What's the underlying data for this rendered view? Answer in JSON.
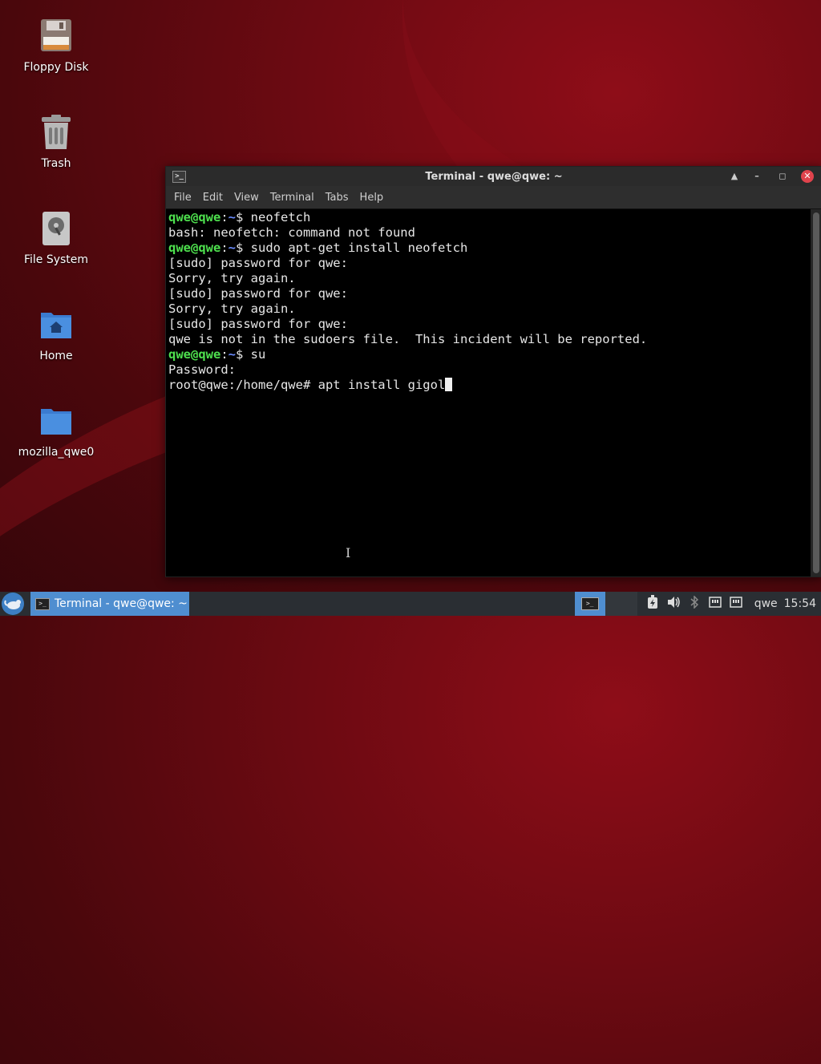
{
  "desktop": {
    "icons": [
      {
        "label": "Floppy Disk"
      },
      {
        "label": "Trash"
      },
      {
        "label": "File System"
      },
      {
        "label": "Home"
      },
      {
        "label": "mozilla_qwe0"
      }
    ]
  },
  "terminal": {
    "title": "Terminal - qwe@qwe: ~",
    "menu": [
      "File",
      "Edit",
      "View",
      "Terminal",
      "Tabs",
      "Help"
    ],
    "lines": [
      {
        "user": "qwe@qwe",
        "path": "~",
        "cmd": "$ neofetch"
      },
      {
        "text": "bash: neofetch: command not found"
      },
      {
        "user": "qwe@qwe",
        "path": "~",
        "cmd": "$ sudo apt-get install neofetch"
      },
      {
        "text": "[sudo] password for qwe:"
      },
      {
        "text": "Sorry, try again."
      },
      {
        "text": "[sudo] password for qwe:"
      },
      {
        "text": "Sorry, try again."
      },
      {
        "text": "[sudo] password for qwe:"
      },
      {
        "text": "qwe is not in the sudoers file.  This incident will be reported."
      },
      {
        "user": "qwe@qwe",
        "path": "~",
        "cmd": "$ su"
      },
      {
        "text": "Password:"
      },
      {
        "text": "root@qwe:/home/qwe# apt install gigol",
        "cursor": true
      }
    ]
  },
  "taskbar": {
    "task_label": "Terminal - qwe@qwe: ~",
    "user": "qwe",
    "clock": "15:54"
  },
  "colors": {
    "prompt_user": "#4ee04e",
    "prompt_path": "#6b8cff",
    "accent": "#4f8ed0",
    "close": "#e0434c"
  }
}
